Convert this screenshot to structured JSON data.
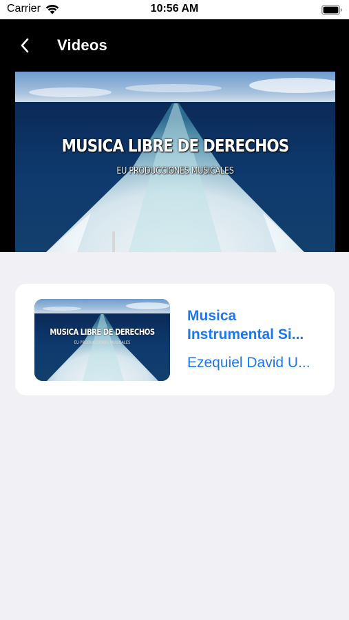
{
  "status_bar": {
    "carrier": "Carrier",
    "time": "10:56 AM",
    "wifi_icon": "wifi-icon",
    "battery_icon": "battery-icon"
  },
  "nav": {
    "back_icon": "chevron-left-icon",
    "title": "Videos"
  },
  "player": {
    "overlay_title": "MUSICA LIBRE DE DERECHOS",
    "overlay_subtitle": "EU PRODUCCIONES MUSICALES"
  },
  "videos": [
    {
      "thumbnail_title": "MUSICA LIBRE DE DERECHOS",
      "thumbnail_subtitle": "EU PRODUCCIONES MUSICALES",
      "title_line1": "Musica",
      "title_line2": "Instrumental Si...",
      "author": "Ezequiel David U..."
    }
  ],
  "colors": {
    "accent": "#1a78f2",
    "background": "#f1f0f5",
    "nav_background": "#000000",
    "card_background": "#ffffff"
  }
}
